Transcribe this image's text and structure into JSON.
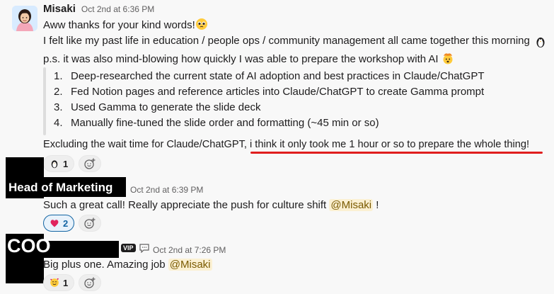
{
  "messages": [
    {
      "author": "Misaki",
      "timestamp": "Oct 2nd at 6:36 PM",
      "line1_text": "Aww thanks for your kind words!",
      "line1_emoji": "pleading-face",
      "line2_text": "I felt like my past life in education / people ops / community management all came together this morning",
      "line2_emoji": "penguin",
      "ps_text": "p.s. it was also mind-blowing how quickly I was able to prepare the workshop with AI",
      "ps_emoji": "exploding-head",
      "steps": [
        {
          "num": "1.",
          "text": "Deep-researched the current state of AI adoption and best practices in Claude/ChatGPT"
        },
        {
          "num": "2.",
          "text": "Fed Notion pages and reference articles into Claude/ChatGPT to create Gamma prompt"
        },
        {
          "num": "3.",
          "text": "Used Gamma to generate the slide deck"
        },
        {
          "num": "4.",
          "text": "Manually fine-tuned the slide order and formatting (~45 min or so)"
        }
      ],
      "closing_text": "Excluding the wait time for Claude/ChatGPT, i think it only took me 1 hour or so to prepare the whole thing!",
      "reactions": [
        {
          "emoji": "penguin",
          "count": "1"
        }
      ]
    },
    {
      "author_label": "Head of Marketing",
      "timestamp": "Oct 2nd at 6:39 PM",
      "text_before": "Such a great call! Really appreciate the push for culture shift ",
      "mention": "@Misaki",
      "text_after": " !",
      "reactions": [
        {
          "emoji": "red-heart",
          "count": "2"
        }
      ]
    },
    {
      "author_label": "COO",
      "badge": "VIP",
      "timestamp": "Oct 2nd at 7:26 PM",
      "text_before": "Big plus one. Amazing job ",
      "mention": "@Misaki",
      "reactions": [
        {
          "emoji": "smiling-face-with-hearts",
          "count": "1"
        }
      ]
    }
  ],
  "colors": {
    "mention_bg": "#fbf0d2",
    "mention_fg": "#7a5a00",
    "reaction_active": "#1264a3",
    "underline": "#e01e1e"
  }
}
